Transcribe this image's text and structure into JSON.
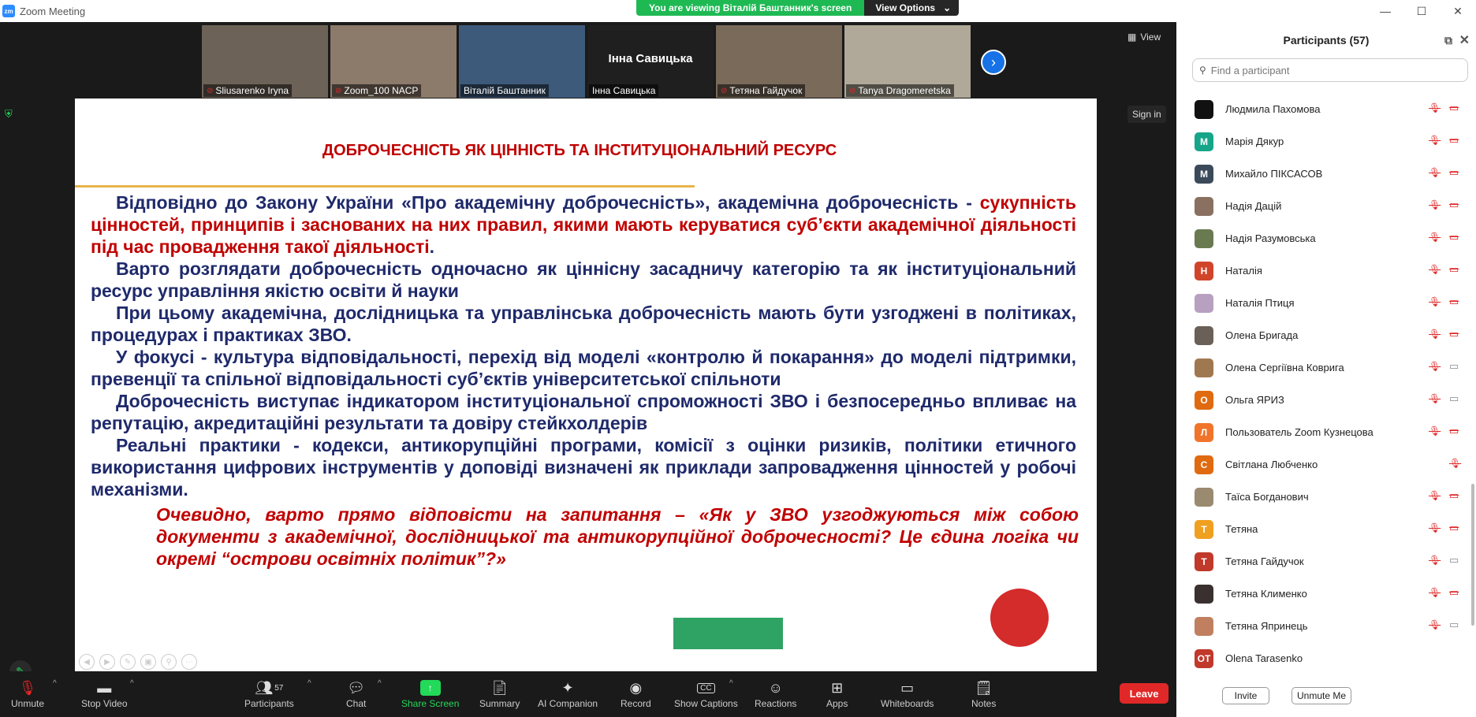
{
  "window": {
    "title": "Zoom Meeting",
    "logo": "zm",
    "minimize": "—",
    "maximize": "☐",
    "close": "✕"
  },
  "banner": {
    "viewing_text": "You are viewing Віталій Баштанник's screen",
    "view_options": "View Options",
    "caret": "⌄"
  },
  "thumbnails": [
    {
      "name": "Sliusarenko Iryna",
      "muted": true,
      "bg": "#6d6257"
    },
    {
      "name": "Zoom_100 NACP",
      "muted": true,
      "bg": "#8c7a6a"
    },
    {
      "name": "Віталій Баштанник",
      "muted": false,
      "bg": "#3d5a7a",
      "active": true
    },
    {
      "name": "Інна Савицька",
      "muted": false,
      "bg": "#1f1f1f",
      "center_name": "Інна Савицька"
    },
    {
      "name": "Тетяна Гайдучок",
      "muted": true,
      "bg": "#7a6a5a"
    },
    {
      "name": "Tanya Dragomeretska",
      "muted": true,
      "bg": "#b0a898"
    }
  ],
  "next_arrow": "›",
  "view_label": "View",
  "signin_label": "Sign in",
  "slide": {
    "title": "ДОБРОЧЕСНІСТЬ ЯК ЦІННІСТЬ ТА ІНСТИТУЦІОНАЛЬНИЙ РЕСУРС",
    "p1_a": "Відповідно до Закону України «Про академічну доброчесність», академічна доброчесність - ",
    "p1_red": "сукупність цінностей, принципів і заснованих на них правил, якими мають керуватися суб’єкти академічної діяльності під час провадження такої діяльності",
    "p1_b": ".",
    "p2": "Варто розглядати доброчесність одночасно як ціннісну засадничу категорію та як інституціональний ресурс управління якістю освіти й науки",
    "p3": "При цьому академічна, дослідницька та управлінська доброчесність мають бути узгоджені в політиках, процедурах і практиках ЗВО.",
    "p4": "У фокусі - культура відповідальності, перехід від моделі «контролю й покарання» до моделі підтримки, превенції та спільної відповідальності суб’єктів університетської спільноти",
    "p5": "Доброчесність виступає індикатором інституціональної спроможності ЗВО і безпосередньо впливає на репутацію, акредитаційні результати та довіру стейкхолдерів",
    "p6": "Реальні практики  - кодекси, антикорупційні програми, комісії з оцінки ризиків, політики етичного використання цифрових інструментів у доповіді визначені як приклади запровадження цінностей у робочі механізми.",
    "quote": "Очевидно, варто прямо відповісти на запитання – «Як у ЗВО узгоджуються між собою документи з академічної, дослідницької та антикорупційної доброчесності? Це єдина логіка чи окремі “острови освітніх політик”?»"
  },
  "toolbar": {
    "unmute": "Unmute",
    "stop_video": "Stop Video",
    "participants": "Participants",
    "participants_count": "57",
    "chat": "Chat",
    "share_screen": "Share Screen",
    "summary": "Summary",
    "ai_companion": "AI Companion",
    "record": "Record",
    "show_captions": "Show Captions",
    "reactions": "Reactions",
    "apps": "Apps",
    "whiteboards": "Whiteboards",
    "notes": "Notes",
    "leave": "Leave"
  },
  "panel": {
    "title": "Participants (57)",
    "search_placeholder": "Find a participant",
    "invite": "Invite",
    "unmute_me": "Unmute Me",
    "participants": [
      {
        "name": "Людмила Пахомова",
        "initial": "",
        "color": "#111111",
        "photo": false,
        "mic_muted": true,
        "cam_off": true
      },
      {
        "name": "Марія Дякур",
        "initial": "М",
        "color": "#17a589",
        "photo": false,
        "mic_muted": true,
        "cam_off": true
      },
      {
        "name": "Михайло ПІКСАСОВ",
        "initial": "М",
        "color": "#3b4a5a",
        "photo": false,
        "mic_muted": true,
        "cam_off": true
      },
      {
        "name": "Надія Дацій",
        "initial": "",
        "color": "#8a7060",
        "photo": true,
        "mic_muted": true,
        "cam_off": true
      },
      {
        "name": "Надія Разумовська",
        "initial": "",
        "color": "#6a7a50",
        "photo": true,
        "mic_muted": true,
        "cam_off": true
      },
      {
        "name": "Наталія",
        "initial": "Н",
        "color": "#d0452a",
        "photo": false,
        "mic_muted": true,
        "cam_off": true
      },
      {
        "name": "Наталія Птиця",
        "initial": "",
        "color": "#b8a0c0",
        "photo": true,
        "mic_muted": true,
        "cam_off": true
      },
      {
        "name": "Олена Бригада",
        "initial": "",
        "color": "#6a6058",
        "photo": true,
        "mic_muted": true,
        "cam_off": true
      },
      {
        "name": "Олена Сергіївна Коврига",
        "initial": "",
        "color": "#a07850",
        "photo": true,
        "mic_muted": true,
        "cam_off": false
      },
      {
        "name": "Ольга ЯРИЗ",
        "initial": "О",
        "color": "#e06a10",
        "photo": false,
        "mic_muted": true,
        "cam_off": false
      },
      {
        "name": "Пользователь Zoom Кузнецова",
        "initial": "Л",
        "color": "#f0742a",
        "photo": false,
        "mic_muted": true,
        "cam_off": true
      },
      {
        "name": "Світлана Любченко",
        "initial": "С",
        "color": "#e06a10",
        "photo": false,
        "mic_muted": true,
        "cam_off": null
      },
      {
        "name": "Таїса Богданович",
        "initial": "",
        "color": "#9a8a70",
        "photo": true,
        "mic_muted": true,
        "cam_off": true
      },
      {
        "name": "Тетяна",
        "initial": "Т",
        "color": "#f0a020",
        "photo": false,
        "mic_muted": true,
        "cam_off": true
      },
      {
        "name": "Тетяна Гайдучок",
        "initial": "Т",
        "color": "#c0392b",
        "photo": false,
        "mic_muted": true,
        "cam_off": false
      },
      {
        "name": "Тетяна Клименко",
        "initial": "",
        "color": "#3a3030",
        "photo": true,
        "mic_muted": true,
        "cam_off": true
      },
      {
        "name": "Тетяна Япринець",
        "initial": "",
        "color": "#c08060",
        "photo": true,
        "mic_muted": true,
        "cam_off": false
      },
      {
        "name": "Olena Tarasenko",
        "initial": "OT",
        "color": "#c0392b",
        "photo": false,
        "mic_muted": null,
        "cam_off": null
      }
    ]
  }
}
